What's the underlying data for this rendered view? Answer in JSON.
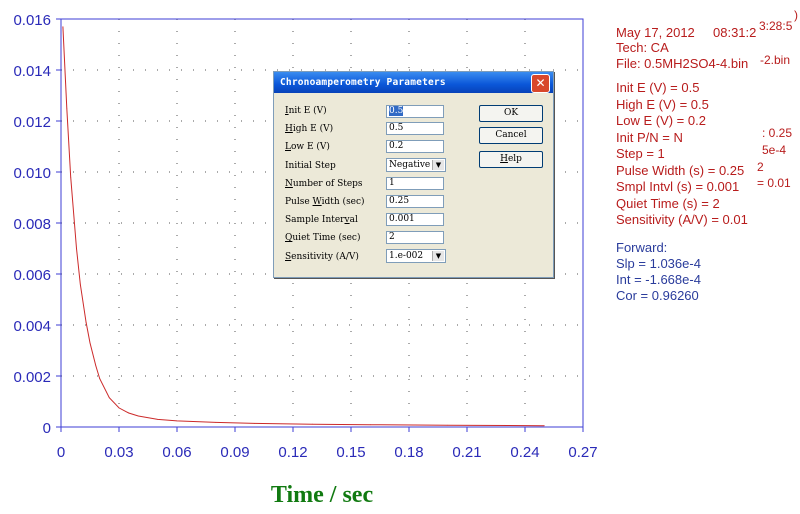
{
  "chart_data": {
    "type": "line",
    "x_axis": {
      "title": "Time / sec",
      "ticks": [
        0,
        0.03,
        0.06,
        0.09,
        0.12,
        0.15,
        0.18,
        0.21,
        0.24,
        0.27
      ],
      "tick_labels": [
        "0",
        "0.03",
        "0.06",
        "0.09",
        "0.12",
        "0.15",
        "0.18",
        "0.21",
        "0.24",
        "0.27"
      ],
      "range": [
        0,
        0.27
      ]
    },
    "y_axis": {
      "title": "",
      "ticks": [
        0,
        0.002,
        0.004,
        0.006,
        0.008,
        0.01,
        0.012,
        0.014,
        0.016
      ],
      "tick_labels": [
        "0",
        "0.002",
        "0.004",
        "0.006",
        "0.008",
        "0.010",
        "0.012",
        "0.014",
        "0.016"
      ],
      "range": [
        0,
        0.016
      ]
    },
    "grid": "dotted",
    "series": [
      {
        "color": "#cc2a2a",
        "x": [
          0.001,
          0.003,
          0.005,
          0.008,
          0.01,
          0.013,
          0.015,
          0.018,
          0.02,
          0.025,
          0.03,
          0.035,
          0.04,
          0.05,
          0.06,
          0.08,
          0.1,
          0.13,
          0.16,
          0.2,
          0.25
        ],
        "y": [
          0.0157,
          0.0125,
          0.0098,
          0.007,
          0.0056,
          0.0041,
          0.0033,
          0.0024,
          0.0019,
          0.00115,
          0.00075,
          0.00055,
          0.00043,
          0.0003,
          0.00024,
          0.00018,
          0.00014,
          0.00011,
          9e-05,
          7e-05,
          5e-05
        ]
      }
    ]
  },
  "info_panel": {
    "date": "May 17, 2012",
    "time": "08:31:2",
    "time_overlap": "3:28:5",
    "time_overlap_suffix": ")",
    "tech": "Tech: CA",
    "file": "File: 0.5MH2SO4-4.bin",
    "file_overlap": "-2.bin",
    "params": [
      "Init E (V) = 0.5",
      "High E (V) = 0.5",
      "Low E (V) = 0.2",
      "Init P/N = N",
      "Step = 1",
      "Pulse Width (s) = 0.25",
      "Smpl Intvl (s) = 0.001",
      "Quiet Time (s) = 2",
      "Sensitivity (A/V) = 0.01"
    ],
    "overlap_fragments": [
      ": 0.25",
      "5e-4",
      "2",
      "= 0.01"
    ],
    "fit_title": "Forward:",
    "fit_lines": [
      "Slp = 1.036e-4",
      "Int = -1.668e-4",
      "Cor = 0.96260"
    ]
  },
  "dialog": {
    "title": "Chronoamperometry Parameters",
    "close_glyph": "✕",
    "fields": {
      "init_e": {
        "label_u": "I",
        "label_rest": "nit E (V)",
        "value": "0.5"
      },
      "high_e": {
        "label_u": "H",
        "label_rest": "igh E (V)",
        "value": "0.5"
      },
      "low_e": {
        "label_u": "L",
        "label_rest": "ow E (V)",
        "value": "0.2"
      },
      "initial_step": {
        "label": "Initial Step",
        "value": "Negative"
      },
      "steps": {
        "label_u": "N",
        "label_rest": "umber of Steps",
        "value": "1"
      },
      "pulse": {
        "label_pre": "Pulse ",
        "label_u": "W",
        "label_rest": "idth (sec)",
        "value": "0.25"
      },
      "sample": {
        "label_pre": "Sample Inter",
        "label_u": "v",
        "label_rest": "al",
        "value": "0.001"
      },
      "quiet": {
        "label_u": "Q",
        "label_rest": "uiet Time (sec)",
        "value": "2"
      },
      "sensitivity": {
        "label_u": "S",
        "label_rest": "ensitivity (A/V)",
        "value": "1.e-002"
      }
    },
    "buttons": {
      "ok": "OK",
      "cancel": "Cancel",
      "help_u": "H",
      "help_rest": "elp"
    },
    "dropdown_arrow": "▼"
  }
}
